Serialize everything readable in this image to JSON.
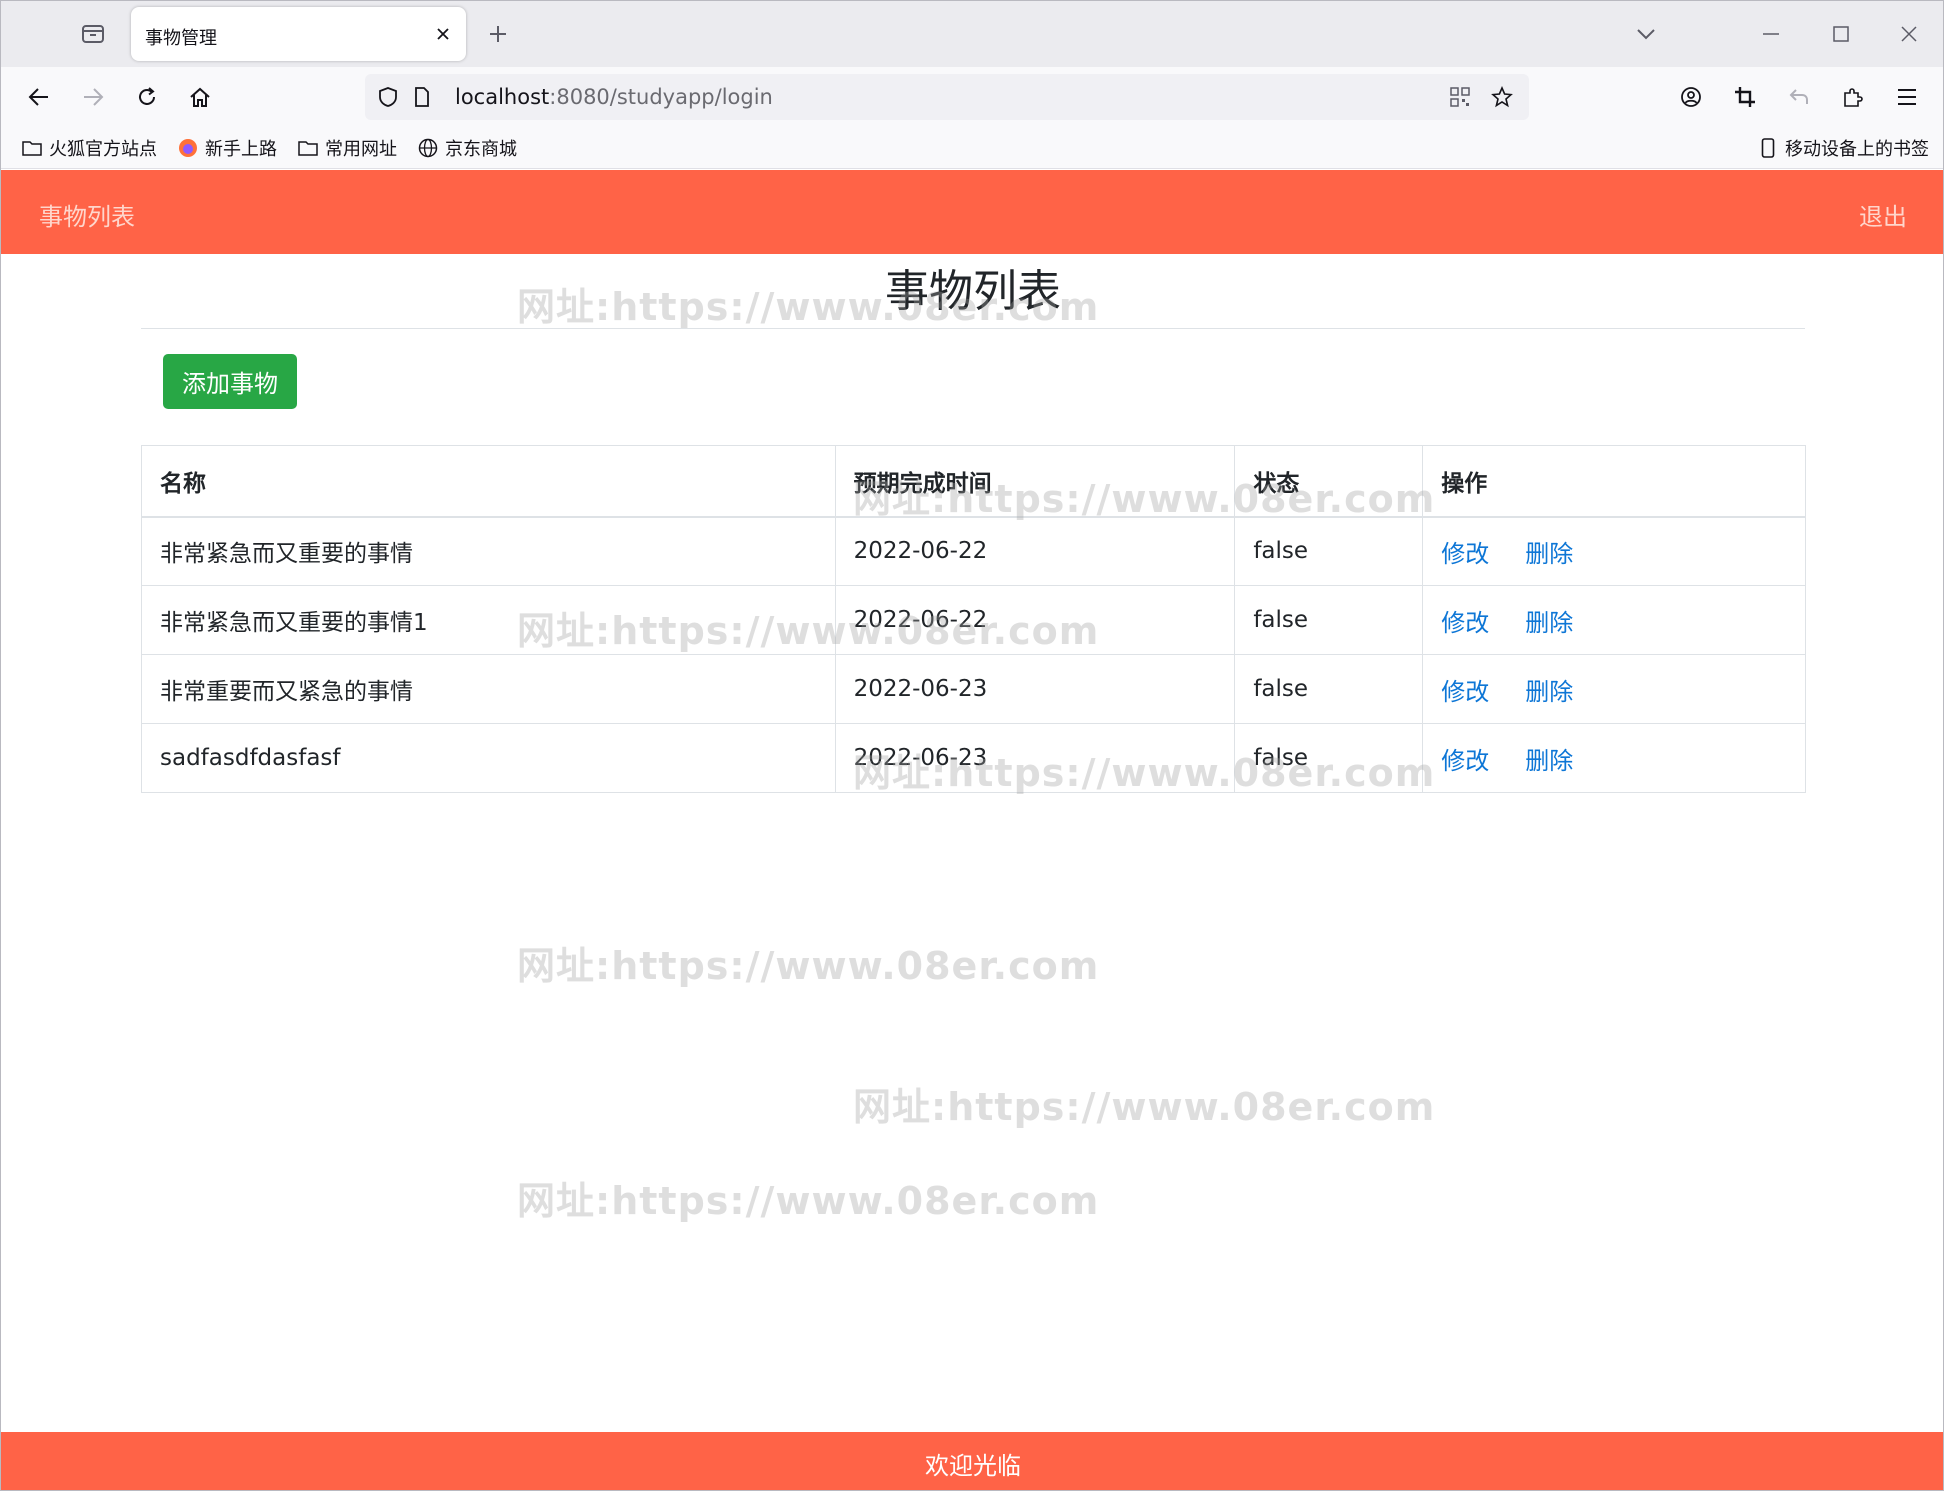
{
  "browser": {
    "tab_title": "事物管理",
    "url_host": "localhost",
    "url_rest": ":8080/studyapp/login",
    "icons": {
      "tabs": "tab-list-icon",
      "close": "close-icon",
      "new_tab": "plus-icon",
      "back": "back-arrow-icon",
      "forward": "forward-arrow-icon",
      "reload": "reload-icon",
      "home": "home-icon",
      "shield": "shield-icon",
      "page": "page-icon",
      "qr": "qr-code-icon",
      "star": "star-icon",
      "account": "account-icon",
      "screenshot": "crop-icon",
      "undo": "undo-icon",
      "extensions": "puzzle-icon",
      "menu": "menu-icon"
    },
    "bookmarks": [
      {
        "label": "火狐官方站点",
        "icon": "folder-icon"
      },
      {
        "label": "新手上路",
        "icon": "firefox-icon"
      },
      {
        "label": "常用网址",
        "icon": "folder-icon"
      },
      {
        "label": "京东商城",
        "icon": "globe-icon"
      }
    ],
    "mobile_bookmarks": "移动设备上的书签"
  },
  "header": {
    "brand": "事物列表",
    "logout": "退出",
    "color": "#ff6347"
  },
  "main": {
    "title": "事物列表",
    "add_button": "添加事物",
    "add_button_color": "#28a745",
    "table": {
      "columns": [
        "名称",
        "预期完成时间",
        "状态",
        "操作"
      ],
      "rows": [
        {
          "name": "非常紧急而又重要的事情",
          "date": "2022-06-22",
          "status": "false",
          "edit": "修改",
          "delete": "删除"
        },
        {
          "name": "非常紧急而又重要的事情1",
          "date": "2022-06-22",
          "status": "false",
          "edit": "修改",
          "delete": "删除"
        },
        {
          "name": "非常重要而又紧急的事情",
          "date": "2022-06-23",
          "status": "false",
          "edit": "修改",
          "delete": "删除"
        },
        {
          "name": "sadfasdfdasfasf",
          "date": "2022-06-23",
          "status": "false",
          "edit": "修改",
          "delete": "删除"
        }
      ]
    }
  },
  "watermark": "网址:https://www.08er.com",
  "footer": {
    "text": "欢迎光临"
  }
}
